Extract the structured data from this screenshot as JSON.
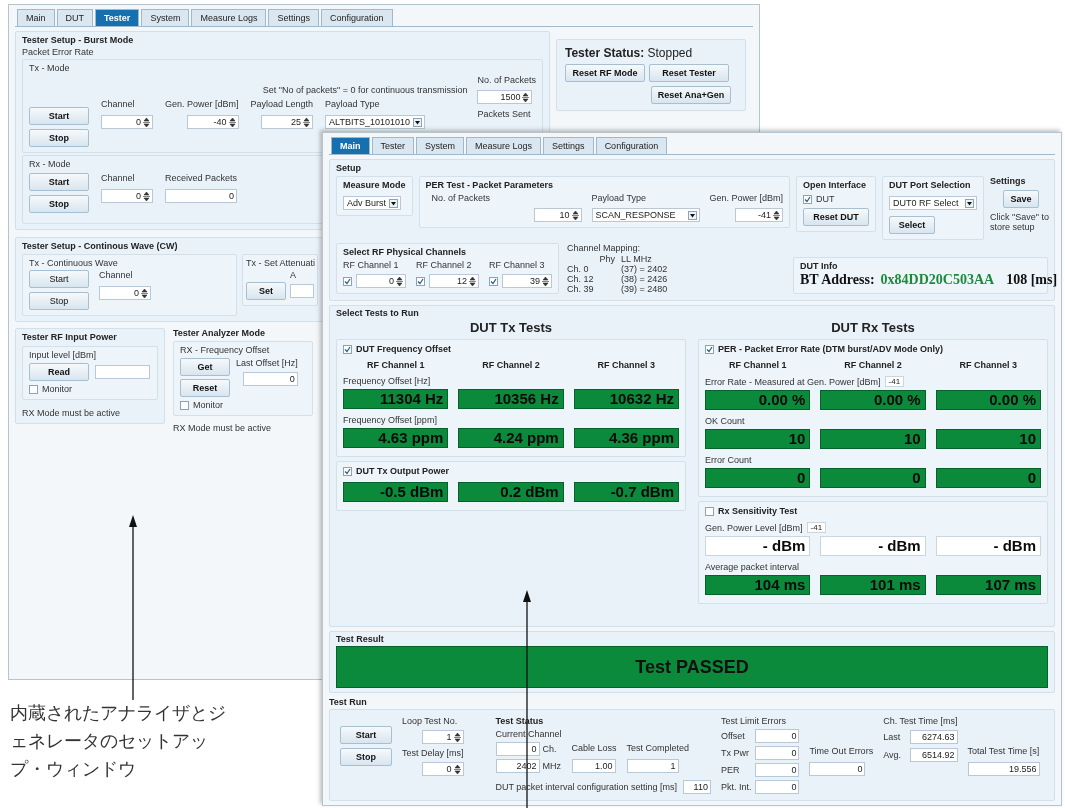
{
  "back_window": {
    "tabs": [
      {
        "label": "Main",
        "selected": false
      },
      {
        "label": "DUT",
        "selected": false
      },
      {
        "label": "Tester",
        "selected": true
      },
      {
        "label": "System",
        "selected": false
      },
      {
        "label": "Measure Logs",
        "selected": false
      },
      {
        "label": "Settings",
        "selected": false
      },
      {
        "label": "Configuration",
        "selected": false
      }
    ],
    "burst": {
      "title": "Tester Setup - Burst Mode",
      "subtitle": "Packet Error Rate",
      "tx": {
        "title": "Tx - Mode",
        "note": "Set \"No of packets\" = 0 for continuous transmission",
        "start": "Start",
        "stop": "Stop",
        "fields": [
          {
            "label": "Channel",
            "value": "0",
            "kind": "spin"
          },
          {
            "label": "Gen. Power [dBm]",
            "value": "-40",
            "kind": "spin"
          },
          {
            "label": "Payload Length",
            "value": "25",
            "kind": "spin"
          },
          {
            "label": "Payload Type",
            "value": "ALTBITS_10101010",
            "kind": "select"
          }
        ],
        "packets": {
          "label": "No. of Packets",
          "value": "1500"
        },
        "sent_label": "Packets Sent"
      },
      "rx": {
        "title": "Rx - Mode",
        "start": "Start",
        "stop": "Stop",
        "fields": [
          {
            "label": "Channel",
            "value": "0",
            "kind": "spin"
          },
          {
            "label": "Received Packets",
            "value": "0",
            "kind": "text"
          }
        ]
      }
    },
    "status": {
      "title": "**Tester Status:** Stopped",
      "buttons": [
        "Reset RF Mode",
        "Reset Tester",
        "Reset Ana+Gen"
      ]
    },
    "cw": {
      "title": "Tester Setup - Continous Wave (CW)",
      "tx": {
        "title": "Tx - Continuous Wave",
        "start": "Start",
        "stop": "Stop",
        "channel": {
          "label": "Channel",
          "value": "0"
        }
      },
      "atten": {
        "title": "Tx - Set Attenuati",
        "button": "Set",
        "label": "A"
      }
    },
    "rf_input": {
      "title": "Tester RF Input Power",
      "label": "Input level [dBm]",
      "button": "Read",
      "monitor": {
        "label": "Monitor",
        "checked": false
      },
      "note": "RX Mode must be active"
    },
    "analyzer": {
      "title": "Tester Analyzer Mode",
      "subtitle": "RX - Frequency Offset",
      "buttons": [
        "Get",
        "Reset"
      ],
      "monitor": {
        "label": "Monitor",
        "checked": false
      },
      "offset": {
        "label": "Last Offset [Hz]",
        "value": "0"
      },
      "note": "RX Mode must be active"
    }
  },
  "front_window": {
    "tabs": [
      {
        "label": "Main",
        "selected": true
      },
      {
        "label": "Tester",
        "selected": false
      },
      {
        "label": "System",
        "selected": false
      },
      {
        "label": "Measure Logs",
        "selected": false
      },
      {
        "label": "Settings",
        "selected": false
      },
      {
        "label": "Configuration",
        "selected": false
      }
    ],
    "setup": {
      "title": "Setup",
      "measure_mode": {
        "title": "Measure Mode",
        "value": "Adv Burst"
      },
      "per": {
        "title": "PER Test - Packet Parameters",
        "fields": [
          {
            "label": "No. of Packets",
            "value": "10",
            "kind": "spin"
          },
          {
            "label": "Payload Type",
            "value": "SCAN_RESPONSE",
            "kind": "select"
          },
          {
            "label": "Gen. Power [dBm]",
            "value": "-41",
            "kind": "spin"
          }
        ]
      },
      "open_interface": {
        "title": "Open Interface",
        "dut": {
          "label": "DUT",
          "checked": true
        },
        "button": "Reset DUT"
      },
      "port": {
        "title": "DUT Port Selection",
        "value": "DUT0 RF Select",
        "button": "Select"
      },
      "settings": {
        "title": "Settings",
        "button": "Save",
        "note": "Click \"Save\" to store setup"
      },
      "channels": {
        "title": "Select RF Physical Channels",
        "items": [
          {
            "label": "RF Channel 1",
            "checked": true,
            "value": "0"
          },
          {
            "label": "RF Channel 2",
            "checked": true,
            "value": "12"
          },
          {
            "label": "RF Channel 3",
            "checked": true,
            "value": "39"
          }
        ]
      },
      "mapping": {
        "title": "Channel Mapping:",
        "header": [
          "Phy",
          "LL",
          "MHz"
        ],
        "rows": [
          [
            "Ch. 0",
            "(37) = 2402"
          ],
          [
            "Ch. 12",
            "(38) = 2426"
          ],
          [
            "Ch. 39",
            "(39) = 2480"
          ]
        ]
      },
      "dut_info": {
        "title": "DUT Info",
        "label": "BT Address:",
        "address": "0x84DD20C503AA",
        "time": "108 [ms]"
      }
    },
    "tests": {
      "title": "Select Tests to Run",
      "tx": {
        "heading": "DUT Tx Tests",
        "groups": [
          {
            "label": "DUT Frequency Offset",
            "checked": true,
            "channels": [
              "RF Channel 1",
              "RF Channel 2",
              "RF Channel 3"
            ],
            "rows": [
              {
                "label": "Frequency Offset [Hz]",
                "measured": true,
                "values": [
                  "11304 Hz",
                  "10356 Hz",
                  "10632 Hz"
                ]
              },
              {
                "label": "Frequency Offset [ppm]",
                "measured": true,
                "values": [
                  "4.63 ppm",
                  "4.24 ppm",
                  "4.36 ppm"
                ]
              }
            ]
          },
          {
            "label": "DUT Tx Output Power",
            "checked": true,
            "rows": [
              {
                "measured": true,
                "values": [
                  "-0.5 dBm",
                  "0.2 dBm",
                  "-0.7 dBm"
                ]
              }
            ]
          }
        ]
      },
      "rx": {
        "heading": "DUT Rx Tests",
        "groups": [
          {
            "label": "PER - Packet Error Rate (DTM burst/ADV Mode Only)",
            "checked": true,
            "channels": [
              "RF Channel 1",
              "RF Channel 2",
              "RF Channel 3"
            ],
            "rows": [
              {
                "label": "Error Rate - Measured at Gen. Power [dBm]",
                "tag": "-41",
                "measured": true,
                "values": [
                  "0.00 %",
                  "0.00 %",
                  "0.00 %"
                ]
              },
              {
                "label": "OK Count",
                "measured": true,
                "values": [
                  "10",
                  "10",
                  "10"
                ]
              },
              {
                "label": "Error Count",
                "measured": true,
                "values": [
                  "0",
                  "0",
                  "0"
                ]
              }
            ]
          },
          {
            "label": "Rx Sensitivity Test",
            "checked": false,
            "rows": [
              {
                "label": "Gen. Power Level [dBm]",
                "tag": "-41",
                "measured": false,
                "values": [
                  "- dBm",
                  "- dBm",
                  "- dBm"
                ]
              },
              {
                "label": "Average packet interval",
                "measured": true,
                "values": [
                  "104 ms",
                  "101 ms",
                  "107 ms"
                ]
              }
            ]
          }
        ]
      }
    },
    "result": {
      "title": "Test Result",
      "text": "Test PASSED",
      "passed": true
    },
    "run": {
      "title": "Test Run",
      "buttons": [
        "Start",
        "Stop"
      ],
      "loop": {
        "label": "Loop Test No.",
        "value": "1"
      },
      "delay": {
        "label": "Test Delay [ms]",
        "value": "0"
      },
      "status": {
        "title": "Test Status",
        "current_label": "Current Channel",
        "channel": "0",
        "channel_unit": "Ch.",
        "mhz": "2402",
        "mhz_unit": "MHz",
        "cable": {
          "label": "Cable Loss",
          "value": "1.00"
        },
        "completed": {
          "label": "Test Completed",
          "value": "1"
        },
        "interval": {
          "label": "DUT packet interval configuration setting [ms]",
          "value": "110"
        }
      },
      "limits": {
        "title": "Test Limit Errors",
        "items": [
          {
            "label": "Offset",
            "value": "0"
          },
          {
            "label": "Tx Pwr",
            "value": "0"
          },
          {
            "label": "PER",
            "value": "0"
          },
          {
            "label": "Pkt. Int.",
            "value": "0"
          }
        ]
      },
      "timeouts": {
        "label": "Time Out Errors",
        "value": "0"
      },
      "ch_time": {
        "title": "Ch. Test Time [ms]",
        "items": [
          {
            "label": "Last",
            "value": "6274.63"
          },
          {
            "label": "Avg.",
            "value": "6514.92"
          }
        ]
      },
      "total": {
        "label": "Total Test Time [s]",
        "value": "19.556"
      }
    }
  },
  "caption": "内蔵されたアナライザとジェネレータのセットアップ・ウィンドウ"
}
